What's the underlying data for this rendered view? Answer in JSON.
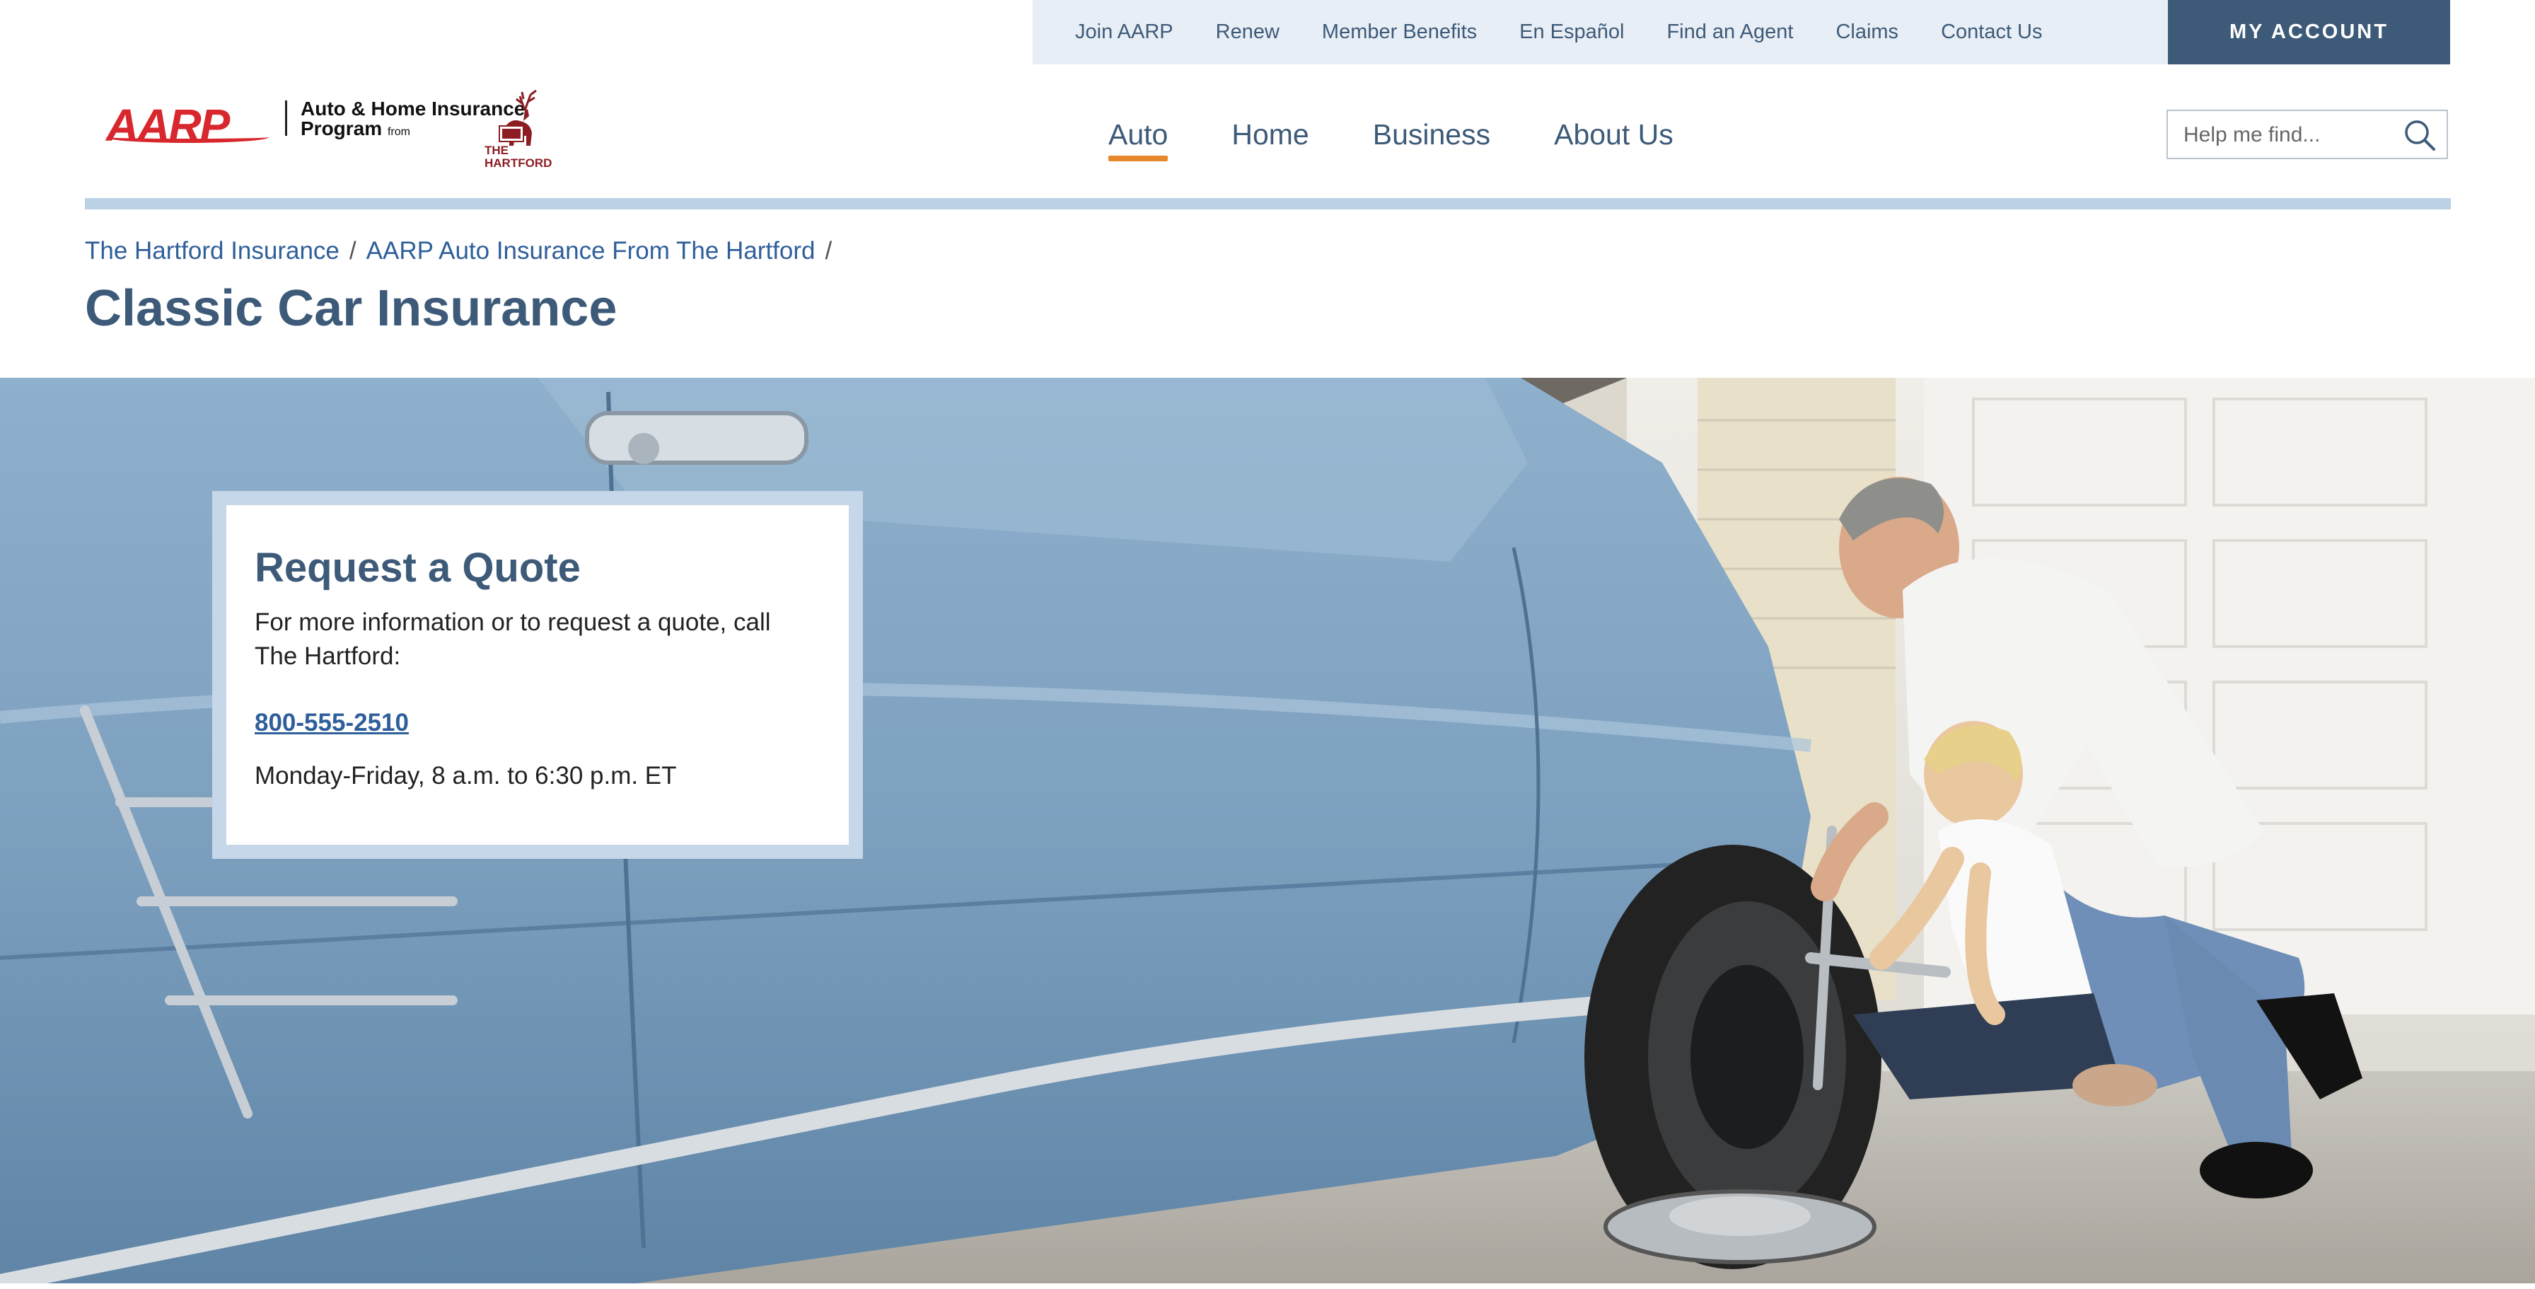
{
  "utility_nav": {
    "links": [
      "Join AARP",
      "Renew",
      "Member Benefits",
      "En Español",
      "Find an Agent",
      "Claims",
      "Contact Us"
    ],
    "account_label": "MY ACCOUNT"
  },
  "logo": {
    "brand": "AARP",
    "program_line1": "Auto & Home Insurance",
    "program_line2": "Program",
    "program_from": "from",
    "partner_line1": "THE",
    "partner_line2": "HARTFORD"
  },
  "main_nav": {
    "items": [
      "Auto",
      "Home",
      "Business",
      "About Us"
    ],
    "active": "Auto"
  },
  "search": {
    "placeholder": "Help me find..."
  },
  "breadcrumb": {
    "items": [
      "The Hartford Insurance",
      "AARP Auto Insurance From The Hartford"
    ],
    "separator": "/"
  },
  "page_title": "Classic Car Insurance",
  "quote_card": {
    "title": "Request a Quote",
    "text": "For more information or to request a quote, call The Hartford:",
    "phone": "800-555-2510",
    "hours": "Monday-Friday, 8 a.m. to 6:30 p.m. ET"
  },
  "colors": {
    "brand_navy": "#3d5a78",
    "link_blue": "#2f5f9a",
    "accent_orange": "#e6882a",
    "aarp_red": "#d8282e",
    "utility_bg": "#e8eef5",
    "accent_bar": "#bad1e6"
  },
  "icons": {
    "search": "magnifier-icon"
  }
}
